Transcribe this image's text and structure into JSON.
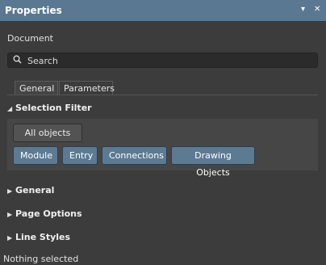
{
  "window": {
    "title": "Properties",
    "menu_glyph": "▾",
    "close_glyph": "✕"
  },
  "panel": {
    "object_type": "Document",
    "search": {
      "placeholder": "Search"
    },
    "tabs": [
      {
        "label": "General",
        "active": true
      },
      {
        "label": "Parameters",
        "active": false
      }
    ],
    "selection_filter": {
      "header": "Selection Filter",
      "expanded": true,
      "all_objects_label": "All objects",
      "buttons": [
        {
          "label": "Module",
          "active": true
        },
        {
          "label": "Entry",
          "active": true
        },
        {
          "label": "Connections",
          "active": true
        },
        {
          "label": "Drawing Objects",
          "active": true
        }
      ]
    },
    "sections": [
      {
        "label": "General",
        "expanded": false
      },
      {
        "label": "Page Options",
        "expanded": false
      },
      {
        "label": "Line Styles",
        "expanded": false
      }
    ]
  },
  "status": {
    "text": "Nothing selected"
  },
  "icons": {
    "search": "🔍",
    "expanded": "◢",
    "collapsed": "▶"
  },
  "colors": {
    "titlebar": "#5a7891",
    "active_button": "#5d7a93",
    "panel": "#3c3c3c"
  }
}
